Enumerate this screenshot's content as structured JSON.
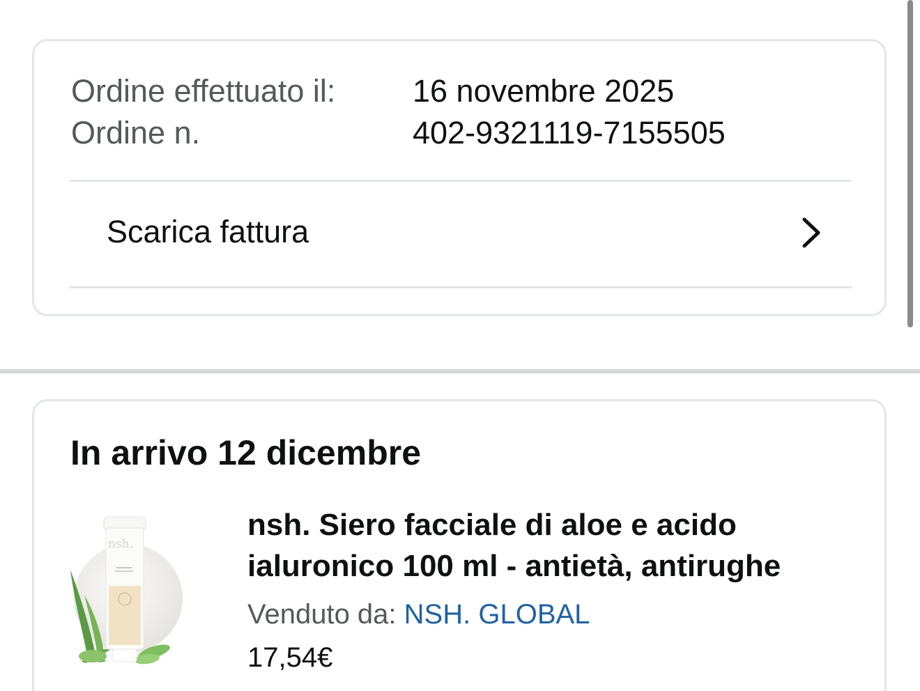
{
  "order_info": {
    "date_label": "Ordine effettuato il:",
    "date_value": "16 novembre 2025",
    "number_label": "Ordine n.",
    "number_value": "402-9321119-7155505",
    "invoice_label": "Scarica fattura"
  },
  "shipment": {
    "title": "In arrivo 12 dicembre",
    "product": {
      "title": "nsh. Siero facciale di aloe e acido ialuronico 100 ml - antietà, antirughe",
      "seller_label": "Venduto da:",
      "seller_name": "NSH. GLOBAL",
      "price": "17,54€",
      "image_brand_text": "nsh."
    }
  },
  "icons": {
    "invoice_chevron": "chevron-right-icon"
  },
  "colors": {
    "text_primary": "#0f1111",
    "text_secondary": "#565959",
    "link": "#2162a1",
    "border": "#e3e6e6",
    "section_separator": "#d5d9d9"
  }
}
